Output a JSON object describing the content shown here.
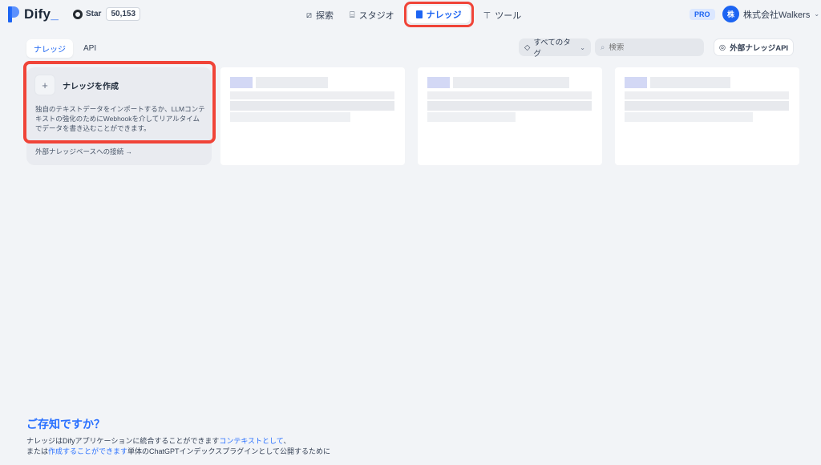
{
  "header": {
    "logo_text": "Dify",
    "logo_dot": "_",
    "github": {
      "label": "Star",
      "count": "50,153"
    },
    "nav": [
      {
        "id": "explore",
        "label": "探索",
        "icon": "compass-icon"
      },
      {
        "id": "studio",
        "label": "スタジオ",
        "icon": "robot-icon"
      },
      {
        "id": "knowledge",
        "label": "ナレッジ",
        "icon": "book-icon",
        "active": true
      },
      {
        "id": "tools",
        "label": "ツール",
        "icon": "hammer-icon"
      }
    ],
    "plan_badge": "PRO",
    "account": {
      "avatar_letter": "株",
      "name": "株式会社Walkers"
    }
  },
  "toolbar": {
    "tabs": [
      {
        "label": "ナレッジ",
        "active": true
      },
      {
        "label": "API",
        "active": false
      }
    ],
    "tag_filter_label": "すべてのタグ",
    "search_placeholder": "検索",
    "external_api_label": "外部ナレッジAPI"
  },
  "create_card": {
    "title": "ナレッジを作成",
    "description": "独自のテキストデータをインポートするか、LLMコンテキストの強化のためにWebhookを介してリアルタイムでデータを書き込むことができます。",
    "external_link": "外部ナレッジベースへの接続 →"
  },
  "did_you_know": {
    "title": "ご存知ですか？",
    "line1_prefix": "ナレッジはDifyアプリケーションに統合することができます",
    "line1_link": "コンテキストとして",
    "line1_suffix": "、",
    "line2_prefix": "または",
    "line2_link": "作成することができます",
    "line2_suffix": "単体のChatGPTインデックスプラグインとして公開するために"
  },
  "colors": {
    "accent": "#1c64f2",
    "highlight": "#f04438",
    "background": "#f2f4f7"
  }
}
